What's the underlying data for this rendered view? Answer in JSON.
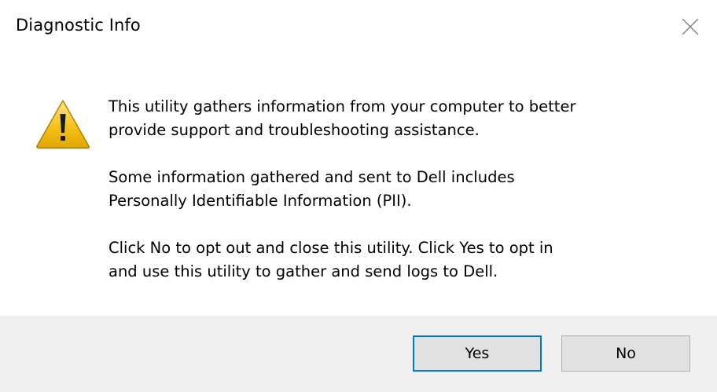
{
  "window": {
    "title": "Diagnostic Info",
    "close_icon": "close-icon"
  },
  "dialog": {
    "icon": "warning-icon",
    "paragraphs": [
      "This utility gathers information from your computer to better\nprovide support and troubleshooting assistance.",
      "Some information gathered and sent to Dell includes\nPersonally Identifiable Information (PII).",
      "Click No to opt out and close this utility. Click Yes to opt in\nand use this utility to gather and send logs to Dell."
    ]
  },
  "buttons": {
    "yes_label": "Yes",
    "no_label": "No",
    "default": "yes"
  },
  "colors": {
    "footer_bg": "#f0f0f0",
    "default_button_border": "#0078d7",
    "warning_yellow": "#f6c21a"
  }
}
